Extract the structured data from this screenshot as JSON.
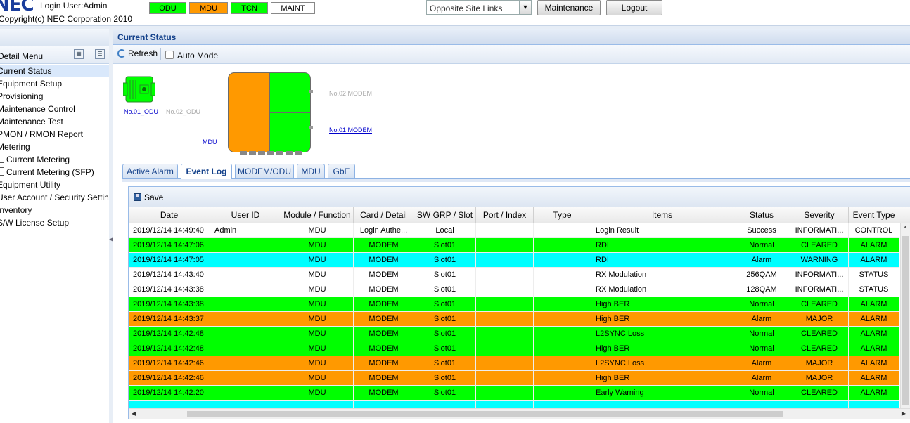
{
  "header": {
    "logo_text": "NEC",
    "login_user": "Login User:Admin",
    "copyright": "Copyright(c) NEC Corporation 2010",
    "status_boxes": [
      {
        "label": "ODU",
        "color": "#00ff00"
      },
      {
        "label": "MDU",
        "color": "#ff9900"
      },
      {
        "label": "TCN",
        "color": "#00ff00"
      },
      {
        "label": "MAINT",
        "color": "#ffffff"
      }
    ],
    "site_select": "Opposite Site Links",
    "maintenance_label": "Maintenance",
    "logout_label": "Logout"
  },
  "sidebar": {
    "title": "Detail Menu",
    "items": [
      {
        "label": "Current Status",
        "selected": true
      },
      {
        "label": "Equipment Setup"
      },
      {
        "label": "Provisioning"
      },
      {
        "label": "Maintenance Control"
      },
      {
        "label": "Maintenance Test"
      },
      {
        "label": "PMON / RMON Report"
      },
      {
        "label": "Metering"
      },
      {
        "label": "Current Metering",
        "checkbox": true
      },
      {
        "label": "Current Metering (SFP)",
        "checkbox": true
      },
      {
        "label": "Equipment Utility"
      },
      {
        "label": "User Account / Security Setting"
      },
      {
        "label": "Inventory"
      },
      {
        "label": "S/W License Setup"
      }
    ]
  },
  "main": {
    "panel_title": "Current Status",
    "refresh_label": "Refresh",
    "auto_mode_label": "Auto Mode",
    "diagram": {
      "odu1_link": "No.01_ODU",
      "odu2_label": "No.02_ODU",
      "mdu_link": "MDU",
      "modem2_label": "No.02 MODEM",
      "modem1_link": "No.01 MODEM",
      "colors": {
        "odu1": "#00ff00",
        "mdu": "#ff9900",
        "modem2": "#00ff00",
        "modem1": "#00ff00"
      }
    },
    "tabs": [
      {
        "label": "Active Alarm"
      },
      {
        "label": "Event Log",
        "active": true
      },
      {
        "label": "MODEM/ODU"
      },
      {
        "label": "MDU"
      },
      {
        "label": "GbE"
      }
    ],
    "save_label": "Save",
    "columns": [
      "Date",
      "User ID",
      "Module / Function",
      "Card / Detail",
      "SW GRP / Slot",
      "Port / Index",
      "Type",
      "Items",
      "Status",
      "Severity",
      "Event Type"
    ],
    "row_colors": {
      "white": "#ffffff",
      "green": "#00ff00",
      "cyan": "#00ffff",
      "orange": "#ff9900"
    },
    "rows": [
      {
        "color": "white",
        "cells": [
          "2019/12/14 14:49:40",
          "Admin",
          "MDU",
          "Login Authe...",
          "Local",
          "",
          "",
          "Login Result",
          "Success",
          "INFORMATI...",
          "CONTROL"
        ]
      },
      {
        "color": "green",
        "cells": [
          "2019/12/14 14:47:06",
          "",
          "MDU",
          "MODEM",
          "Slot01",
          "",
          "",
          "RDI",
          "Normal",
          "CLEARED",
          "ALARM"
        ]
      },
      {
        "color": "cyan",
        "cells": [
          "2019/12/14 14:47:05",
          "",
          "MDU",
          "MODEM",
          "Slot01",
          "",
          "",
          "RDI",
          "Alarm",
          "WARNING",
          "ALARM"
        ]
      },
      {
        "color": "white",
        "cells": [
          "2019/12/14 14:43:40",
          "",
          "MDU",
          "MODEM",
          "Slot01",
          "",
          "",
          "RX Modulation",
          "256QAM",
          "INFORMATI...",
          "STATUS"
        ]
      },
      {
        "color": "white",
        "cells": [
          "2019/12/14 14:43:38",
          "",
          "MDU",
          "MODEM",
          "Slot01",
          "",
          "",
          "RX Modulation",
          "128QAM",
          "INFORMATI...",
          "STATUS"
        ]
      },
      {
        "color": "green",
        "cells": [
          "2019/12/14 14:43:38",
          "",
          "MDU",
          "MODEM",
          "Slot01",
          "",
          "",
          "High BER",
          "Normal",
          "CLEARED",
          "ALARM"
        ]
      },
      {
        "color": "orange",
        "cells": [
          "2019/12/14 14:43:37",
          "",
          "MDU",
          "MODEM",
          "Slot01",
          "",
          "",
          "High BER",
          "Alarm",
          "MAJOR",
          "ALARM"
        ]
      },
      {
        "color": "green",
        "cells": [
          "2019/12/14 14:42:48",
          "",
          "MDU",
          "MODEM",
          "Slot01",
          "",
          "",
          "L2SYNC Loss",
          "Normal",
          "CLEARED",
          "ALARM"
        ]
      },
      {
        "color": "green",
        "cells": [
          "2019/12/14 14:42:48",
          "",
          "MDU",
          "MODEM",
          "Slot01",
          "",
          "",
          "High BER",
          "Normal",
          "CLEARED",
          "ALARM"
        ]
      },
      {
        "color": "orange",
        "cells": [
          "2019/12/14 14:42:46",
          "",
          "MDU",
          "MODEM",
          "Slot01",
          "",
          "",
          "L2SYNC Loss",
          "Alarm",
          "MAJOR",
          "ALARM"
        ]
      },
      {
        "color": "orange",
        "cells": [
          "2019/12/14 14:42:46",
          "",
          "MDU",
          "MODEM",
          "Slot01",
          "",
          "",
          "High BER",
          "Alarm",
          "MAJOR",
          "ALARM"
        ]
      },
      {
        "color": "green",
        "cells": [
          "2019/12/14 14:42:20",
          "",
          "MDU",
          "MODEM",
          "Slot01",
          "",
          "",
          "Early Warning",
          "Normal",
          "CLEARED",
          "ALARM"
        ]
      },
      {
        "color": "cyan",
        "cells": [
          "",
          "",
          "",
          "",
          "",
          "",
          "",
          "",
          "",
          "",
          ""
        ]
      }
    ]
  }
}
